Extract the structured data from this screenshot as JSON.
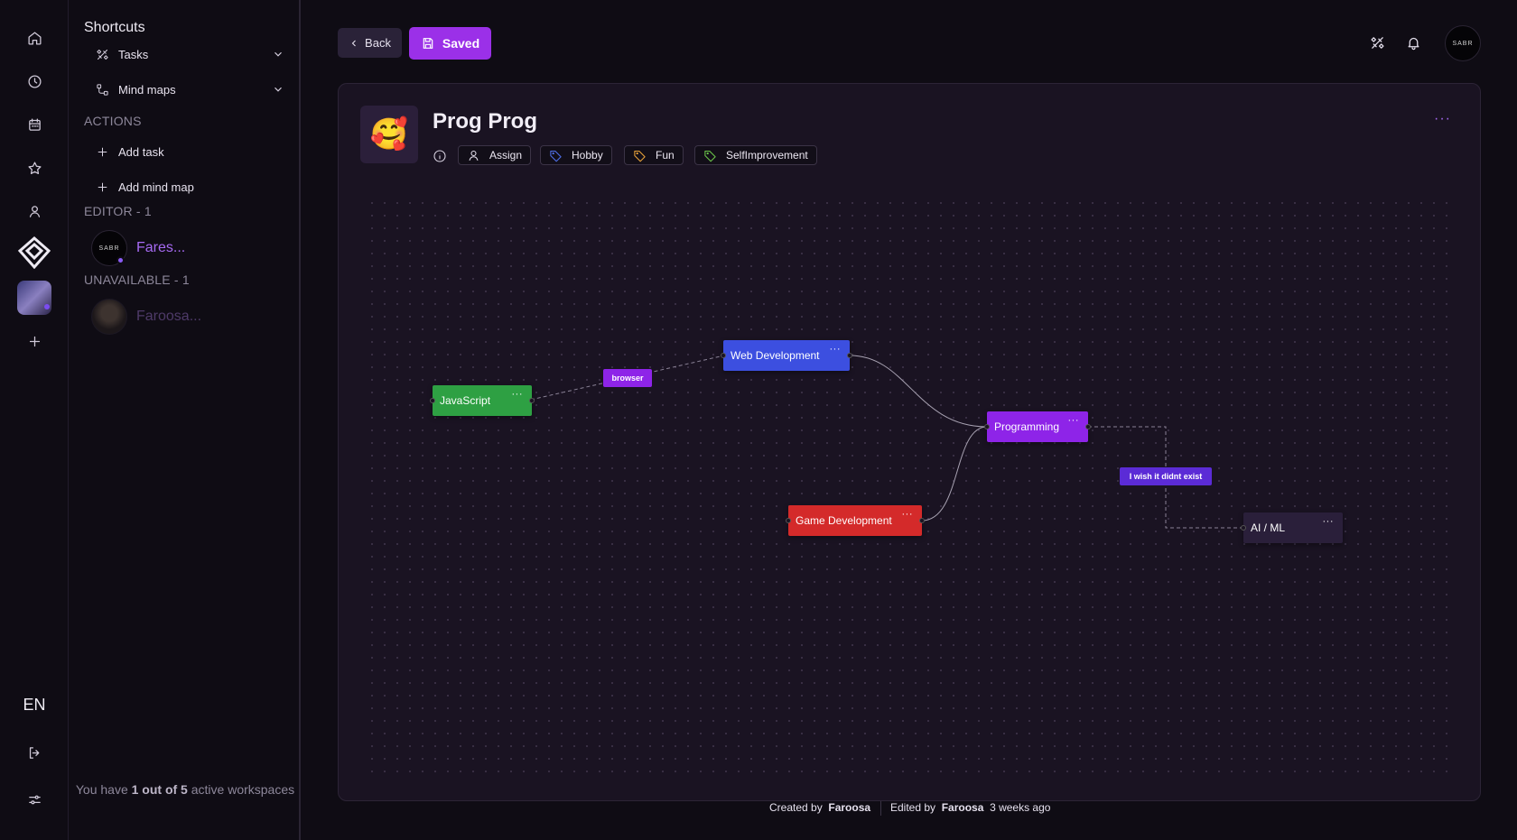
{
  "rail": {
    "icons": [
      "home-icon",
      "clock-icon",
      "calendar-icon",
      "star-icon",
      "user-icon"
    ],
    "language": "EN"
  },
  "shortcuts": {
    "title": "Shortcuts",
    "items": [
      {
        "label": "Tasks",
        "icon": "tasks-icon"
      },
      {
        "label": "Mind maps",
        "icon": "mind-map-icon"
      }
    ],
    "actions_title": "ACTIONS",
    "actions": [
      {
        "label": "Add task"
      },
      {
        "label": "Add mind map"
      }
    ],
    "editor_title": "EDITOR - 1",
    "editor_member": {
      "name": "Fares...",
      "avatar_text": "SABR"
    },
    "unavailable_title": "UNAVAILABLE - 1",
    "unavailable_member": {
      "name": "Faroosa..."
    },
    "footer": {
      "prefix": "You have ",
      "count": "1 out of 5",
      "suffix": " active workspaces"
    }
  },
  "topbar": {
    "back_label": "Back",
    "saved_label": "Saved",
    "avatar_text": "SABR"
  },
  "mindmap": {
    "emoji": "🥰",
    "title": "Prog Prog",
    "more": "···",
    "chips": [
      {
        "label": "Assign",
        "icon": "user-icon",
        "color": "#e6e1ee"
      },
      {
        "label": "Hobby",
        "icon": "tag-icon",
        "color": "#4f6fe8"
      },
      {
        "label": "Fun",
        "icon": "tag-icon",
        "color": "#e8a23a"
      },
      {
        "label": "SelfImprovement",
        "icon": "tag-icon",
        "color": "#6bc44a"
      }
    ],
    "nodes": [
      {
        "id": "js",
        "label": "JavaScript",
        "color": "#2ea043"
      },
      {
        "id": "web",
        "label": "Web Development",
        "color": "#3c4fe0"
      },
      {
        "id": "prog",
        "label": "Programming",
        "color": "#8e24e8"
      },
      {
        "id": "game",
        "label": "Game Development",
        "color": "#d42a2a"
      },
      {
        "id": "ai",
        "label": "AI / ML",
        "color": "#2a1f3a"
      }
    ],
    "node_menu": "···",
    "edge_labels": [
      {
        "label": "browser",
        "color": "#8e24e8"
      },
      {
        "label": "I wish it didnt exist",
        "color": "#5b2bd6"
      }
    ]
  },
  "meta": {
    "created_prefix": "Created by",
    "created_by": "Faroosa",
    "edited_prefix": "Edited by",
    "edited_by": "Faroosa",
    "edited_when": "3 weeks ago"
  }
}
